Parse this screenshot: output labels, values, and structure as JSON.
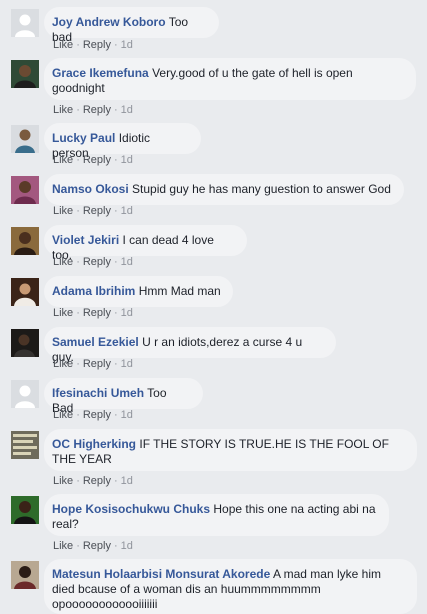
{
  "actions": {
    "like_label": "Like",
    "reply_label": "Reply",
    "separator": "·"
  },
  "comments": [
    {
      "author": "Joy Andrew Koboro",
      "text": "Too bad",
      "time": "1d",
      "avatar": "default-silhouette"
    },
    {
      "author": "Grace Ikemefuna",
      "text": "Very.good of u the gate of hell is open goodnight",
      "time": "1d",
      "avatar": "photo"
    },
    {
      "author": "Lucky Paul",
      "text": "Idiotic person",
      "time": "1d",
      "avatar": "photo"
    },
    {
      "author": "Namso Okosi",
      "text": "Stupid guy he has many guestion to answer God",
      "time": "1d",
      "avatar": "photo"
    },
    {
      "author": "Violet Jekiri",
      "text": "I can dead 4 love too.",
      "time": "1d",
      "avatar": "photo"
    },
    {
      "author": "Adama Ibrihim",
      "text": "Hmm Mad man",
      "time": "1d",
      "avatar": "photo"
    },
    {
      "author": "Samuel Ezekiel",
      "text": "U r an idiots,derez a curse 4 u guy.",
      "time": "1d",
      "avatar": "photo"
    },
    {
      "author": "Ifesinachi Umeh",
      "text": "Too Bad",
      "time": "1d",
      "avatar": "default-silhouette"
    },
    {
      "author": "OC Higherking",
      "text": "IF THE STORY IS TRUE.HE IS THE FOOL OF THE YEAR",
      "time": "1d",
      "avatar": "photo"
    },
    {
      "author": "Hope Kosisochukwu Chuks",
      "text": "Hope this one na acting abi na real?",
      "time": "1d",
      "avatar": "photo"
    },
    {
      "author": "Matesun Holaarbisi Monsurat Akorede",
      "text": "A mad man lyke him died bcause of a woman dis an huummmmmmmm opoooooooooooiiiiiii",
      "time": "",
      "avatar": "photo"
    }
  ]
}
